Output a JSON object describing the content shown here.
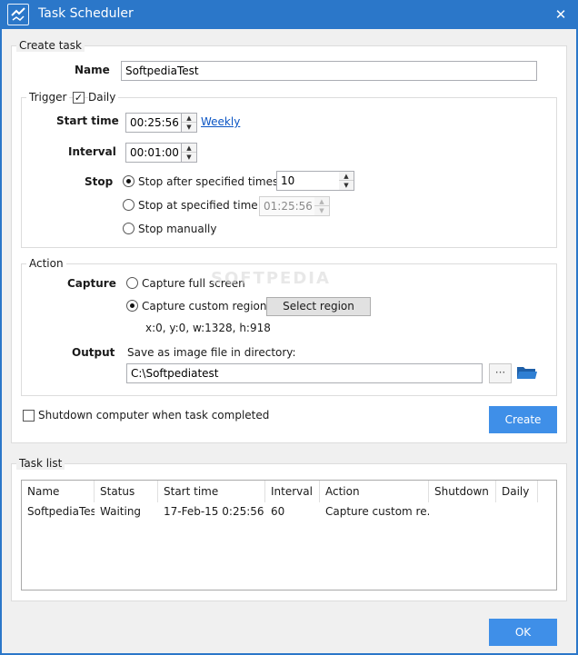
{
  "window": {
    "title": "Task Scheduler",
    "close_glyph": "✕"
  },
  "create_task": {
    "legend": "Create task",
    "name_label": "Name",
    "name_value": "SoftpediaTest",
    "trigger": {
      "legend": "Trigger",
      "daily_label": "Daily",
      "daily_checked": true,
      "start_time_label": "Start time",
      "start_time_value": "00:25:56",
      "weekly_link": "Weekly",
      "interval_label": "Interval",
      "interval_value": "00:01:00",
      "stop_label": "Stop",
      "stop_options": [
        {
          "label": "Stop after specified times:",
          "checked": true
        },
        {
          "label": "Stop at specified time:",
          "checked": false
        },
        {
          "label": "Stop manually",
          "checked": false
        }
      ],
      "stop_times_value": "10",
      "stop_at_time_value": "01:25:56"
    },
    "action": {
      "legend": "Action",
      "capture_label": "Capture",
      "capture_options": [
        {
          "label": "Capture full screen",
          "checked": false
        },
        {
          "label": "Capture custom region",
          "checked": true
        }
      ],
      "select_region_button": "Select region",
      "region_text": "x:0, y:0, w:1328, h:918",
      "output_label": "Output",
      "output_hint": "Save as image file in directory:",
      "output_value": "C:\\Softpediatest",
      "browse_glyph": "···",
      "folder_icon": "folder-icon"
    },
    "shutdown_label": "Shutdown computer when task completed",
    "shutdown_checked": false,
    "create_button": "Create"
  },
  "task_list": {
    "legend": "Task list",
    "columns": [
      "Name",
      "Status",
      "Start time",
      "Interval",
      "Action",
      "Shutdown",
      "Daily"
    ],
    "rows": [
      [
        "SoftpediaTest",
        "Waiting",
        "17-Feb-15 0:25:56",
        "60",
        "Capture custom re...",
        "",
        ""
      ]
    ]
  },
  "ok_button": "OK",
  "watermark": "SOFTPEDIA",
  "colors": {
    "titlebar": "#2b77c9",
    "accent_button": "#3f8fe8",
    "link": "#0b55c4"
  }
}
